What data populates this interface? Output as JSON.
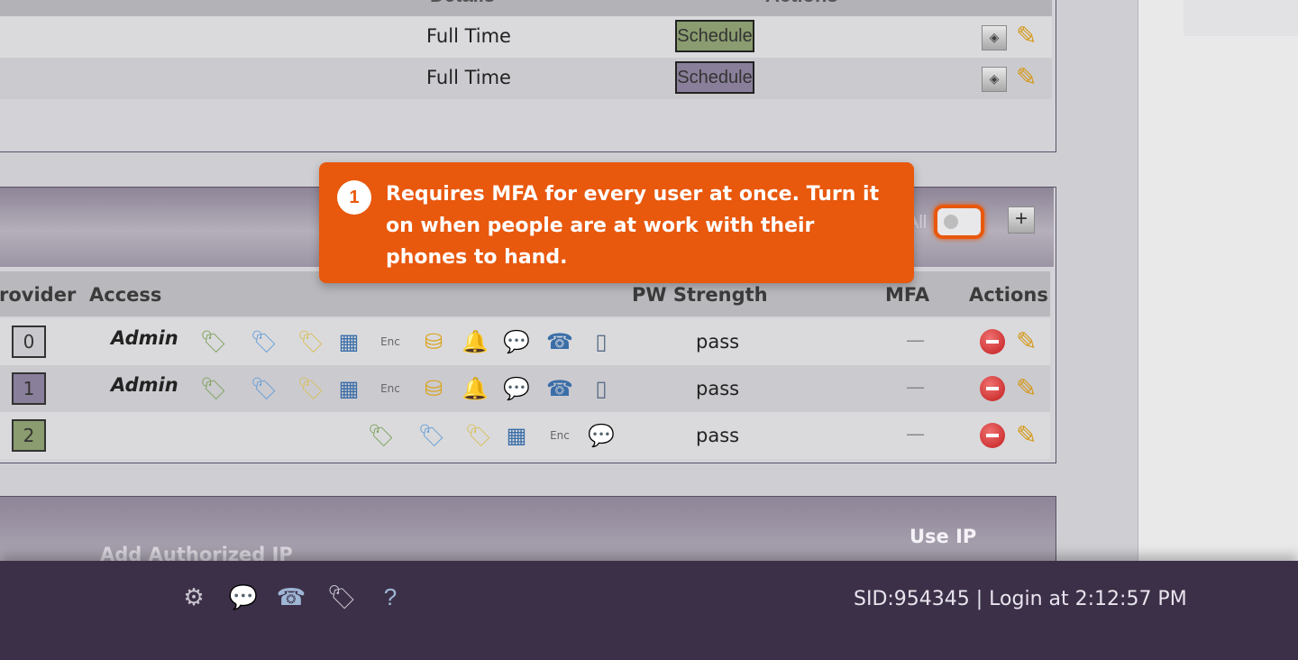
{
  "top_table": {
    "headers": {
      "details": "Details",
      "actions": "Actions"
    },
    "rows": [
      {
        "details": "Full Time",
        "schedule_label": "Schedule",
        "schedule_color": "#8b9c70"
      },
      {
        "details": "Full Time",
        "schedule_label": "Schedule",
        "schedule_color": "#8a7f9a"
      }
    ]
  },
  "users_panel": {
    "mfa_all_label": "All",
    "mfa_all_toggle": "off",
    "columns": {
      "provider": "rovider",
      "access": "Access",
      "pw_strength": "PW Strength",
      "mfa": "MFA",
      "actions": "Actions"
    },
    "rows": [
      {
        "provider": "0",
        "provider_color": "#c9c9cd",
        "access": "Admin",
        "pw_strength": "pass",
        "mfa": "—"
      },
      {
        "provider": "1",
        "provider_color": "#8a7f9a",
        "access": "Admin",
        "pw_strength": "pass",
        "mfa": "—"
      },
      {
        "provider": "2",
        "provider_color": "#8b9c70",
        "access": "",
        "pw_strength": "pass",
        "mfa": "—"
      }
    ]
  },
  "ip_panel": {
    "add_label": "Add Authorized IP",
    "use_ip_label": "Use IP"
  },
  "footer": {
    "status": "SID:954345 | Login at 2:12:57 PM"
  },
  "tooltip": {
    "step": "1",
    "text": "Requires MFA for every user at once. Turn it on when people are at work with their phones to hand."
  },
  "colors": {
    "accent": "#e8580d",
    "footer_bg": "#3c3048"
  }
}
